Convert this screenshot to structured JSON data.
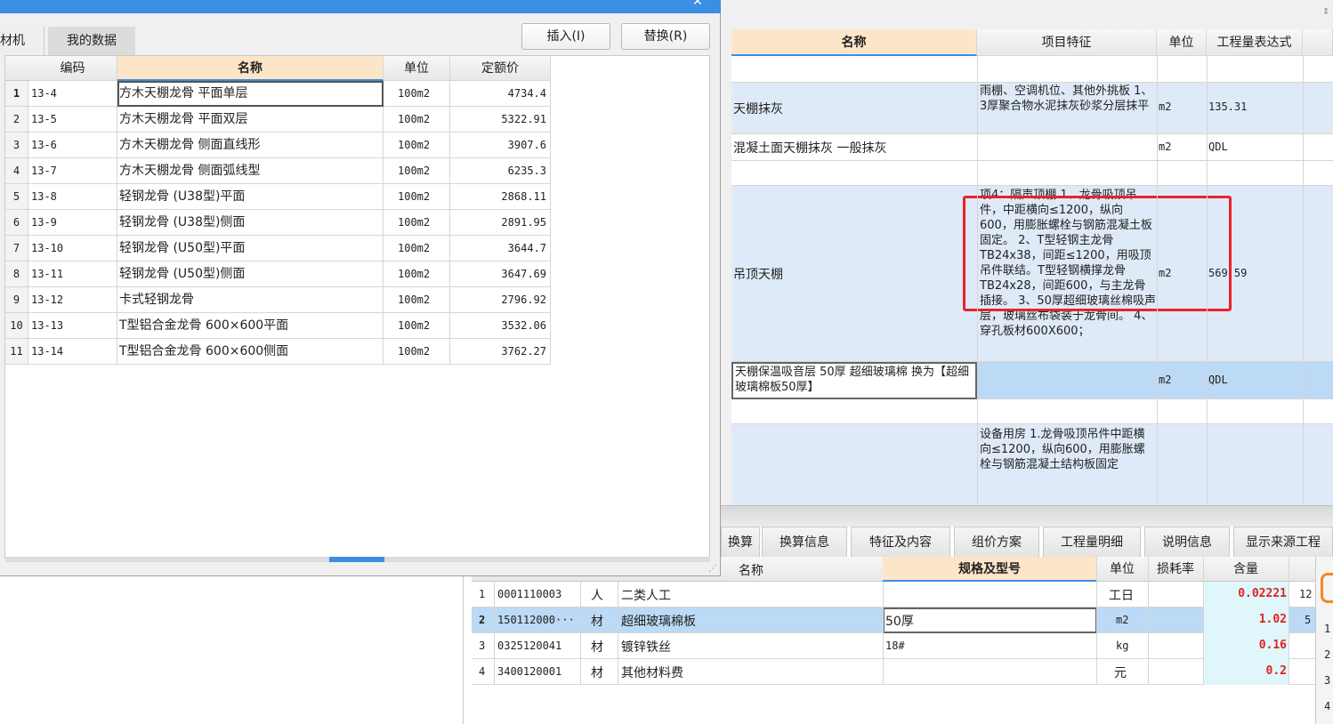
{
  "left_dialog": {
    "tabs": [
      "材机",
      "我的数据"
    ],
    "insert_button": "插入(I)",
    "replace_button": "替换(R)",
    "columns": [
      "编码",
      "名称",
      "单位",
      "定额价"
    ],
    "rows": [
      {
        "no": "1",
        "code": "13-4",
        "name": "方木天棚龙骨 平面单层",
        "unit": "100m2",
        "price": "4734.4"
      },
      {
        "no": "2",
        "code": "13-5",
        "name": "方木天棚龙骨 平面双层",
        "unit": "100m2",
        "price": "5322.91"
      },
      {
        "no": "3",
        "code": "13-6",
        "name": "方木天棚龙骨 侧面直线形",
        "unit": "100m2",
        "price": "3907.6"
      },
      {
        "no": "4",
        "code": "13-7",
        "name": "方木天棚龙骨 侧面弧线型",
        "unit": "100m2",
        "price": "6235.3"
      },
      {
        "no": "5",
        "code": "13-8",
        "name": "轻钢龙骨 (U38型)平面",
        "unit": "100m2",
        "price": "2868.11"
      },
      {
        "no": "6",
        "code": "13-9",
        "name": "轻钢龙骨 (U38型)侧面",
        "unit": "100m2",
        "price": "2891.95"
      },
      {
        "no": "7",
        "code": "13-10",
        "name": "轻钢龙骨 (U50型)平面",
        "unit": "100m2",
        "price": "3644.7"
      },
      {
        "no": "8",
        "code": "13-11",
        "name": "轻钢龙骨 (U50型)侧面",
        "unit": "100m2",
        "price": "3647.69"
      },
      {
        "no": "9",
        "code": "13-12",
        "name": "卡式轻钢龙骨",
        "unit": "100m2",
        "price": "2796.92"
      },
      {
        "no": "10",
        "code": "13-13",
        "name": "T型铝合金龙骨 600×600平面",
        "unit": "100m2",
        "price": "3532.06"
      },
      {
        "no": "11",
        "code": "13-14",
        "name": "T型铝合金龙骨 600×600侧面",
        "unit": "100m2",
        "price": "3762.27"
      }
    ]
  },
  "right_grid": {
    "columns": [
      "名称",
      "项目特征",
      "单位",
      "工程量表达式"
    ],
    "row_a": {
      "name": "天棚抹灰",
      "feature": "雨棚、空调机位、其他外挑板 1、3厚聚合物水泥抹灰砂浆分层抹平",
      "unit": "m2",
      "qty": "135.31"
    },
    "row_b": {
      "name": "混凝土面天棚抹灰 一般抹灰",
      "unit": "m2",
      "qty": "QDL"
    },
    "row_c": {
      "name": "吊顶天棚",
      "feature": "项4：隔声顶棚 1、龙骨吸顶吊件，中距横向≤1200，纵向600，用膨胀螺栓与钢筋混凝土板固定。 2、T型轻钢主龙骨TB24x38，间距≤1200，用吸顶吊件联结。T型轻钢横撑龙骨TB24x28，间距600，与主龙骨插接。 3、50厚超细玻璃丝棉吸声层，玻璃丝布袋装于龙骨间。 4、穿孔板材600X600；",
      "unit": "m2",
      "qty": "569.59"
    },
    "row_d": {
      "name": "天棚保温吸音层 50厚 超细玻璃棉 换为【超细玻璃棉板50厚】",
      "unit": "m2",
      "qty": "QDL"
    },
    "row_e": {
      "feature": "设备用房 1.龙骨吸顶吊件中距横向≤1200，纵向600，用膨胀螺栓与钢筋混凝土结构板固定"
    }
  },
  "bottom_tabs": [
    "换算",
    "换算信息",
    "特征及内容",
    "组价方案",
    "工程量明细",
    "说明信息",
    "显示来源工程"
  ],
  "bottom_grid": {
    "columns": [
      "名称",
      "规格及型号",
      "单位",
      "损耗率",
      "含量"
    ],
    "rows": [
      {
        "no": "1",
        "code": "0001110003",
        "type": "人",
        "name": "二类人工",
        "spec": "",
        "unit": "工日",
        "qty": "0.02221",
        "extra": "12"
      },
      {
        "no": "2",
        "code": "150112000···",
        "type": "材",
        "name": "超细玻璃棉板",
        "spec": "50厚",
        "unit": "m2",
        "qty": "1.02",
        "extra": "5"
      },
      {
        "no": "3",
        "code": "0325120041",
        "type": "材",
        "name": "镀锌铁丝",
        "spec": "18#",
        "unit": "kg",
        "qty": "0.16",
        "extra": ""
      },
      {
        "no": "4",
        "code": "3400120001",
        "type": "材",
        "name": "其他材料费",
        "spec": "",
        "unit": "元",
        "qty": "0.2",
        "extra": ""
      }
    ]
  },
  "side_numbers": [
    "1",
    "2",
    "3",
    "4"
  ],
  "colors": {
    "title_bar": "#3b8fe3",
    "selected_row": "#bcd9f5",
    "header_highlight": "#fde6c8",
    "highlight_box": "#e8232a",
    "qty_red": "#e02020"
  }
}
